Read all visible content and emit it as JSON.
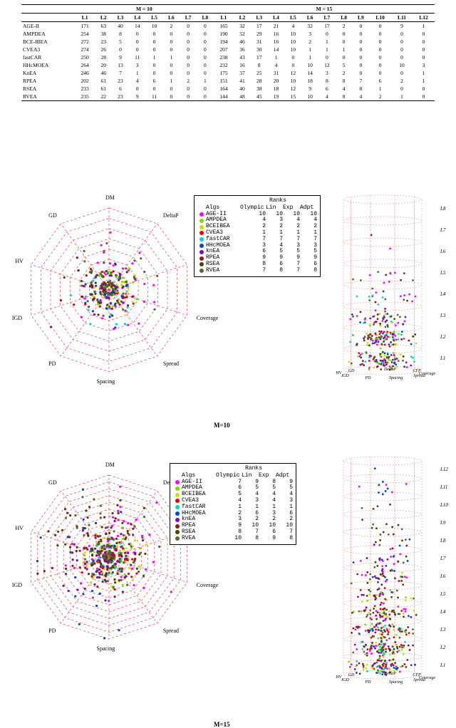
{
  "table": {
    "group_headers": [
      "M = 10",
      "M = 15"
    ],
    "columns_m10": [
      "L1",
      "L2",
      "L3",
      "L4",
      "L5",
      "L6",
      "L7",
      "L8"
    ],
    "columns_m15": [
      "L1",
      "L2",
      "L3",
      "L4",
      "L5",
      "L6",
      "L7",
      "L8",
      "L9",
      "L10",
      "L11",
      "L12"
    ],
    "rows": [
      {
        "name": "AGE-II",
        "m10": [
          171,
          63,
          40,
          14,
          10,
          2,
          0,
          0
        ],
        "m15": [
          165,
          32,
          17,
          21,
          4,
          32,
          17,
          2,
          0,
          0,
          9,
          1
        ]
      },
      {
        "name": "AMPDEA",
        "m10": [
          254,
          38,
          8,
          0,
          0,
          0,
          0,
          0
        ],
        "m15": [
          190,
          52,
          29,
          16,
          10,
          3,
          0,
          0,
          0,
          0,
          0,
          0
        ]
      },
      {
        "name": "BCE-IBEA",
        "m10": [
          272,
          23,
          5,
          0,
          0,
          0,
          0,
          0
        ],
        "m15": [
          194,
          46,
          31,
          16,
          10,
          2,
          1,
          0,
          0,
          0,
          0,
          0
        ]
      },
      {
        "name": "CVEA3",
        "m10": [
          274,
          26,
          0,
          0,
          0,
          0,
          0,
          0
        ],
        "m15": [
          207,
          36,
          30,
          14,
          10,
          1,
          1,
          1,
          0,
          0,
          0,
          0
        ]
      },
      {
        "name": "fastCAR",
        "m10": [
          250,
          28,
          9,
          11,
          1,
          1,
          0,
          0
        ],
        "m15": [
          238,
          43,
          17,
          1,
          0,
          1,
          0,
          0,
          0,
          0,
          0,
          0
        ]
      },
      {
        "name": "HHcMOEA",
        "m10": [
          264,
          20,
          13,
          3,
          0,
          0,
          0,
          0
        ],
        "m15": [
          232,
          16,
          8,
          4,
          0,
          10,
          12,
          5,
          0,
          0,
          10,
          3
        ]
      },
      {
        "name": "KnEA",
        "m10": [
          246,
          46,
          7,
          1,
          0,
          0,
          0,
          0
        ],
        "m15": [
          175,
          37,
          25,
          31,
          12,
          14,
          3,
          2,
          0,
          0,
          0,
          1
        ]
      },
      {
        "name": "RPEA",
        "m10": [
          202,
          61,
          23,
          4,
          6,
          1,
          2,
          1
        ],
        "m15": [
          151,
          41,
          28,
          20,
          10,
          18,
          8,
          8,
          7,
          6,
          2,
          1
        ]
      },
      {
        "name": "RSEA",
        "m10": [
          233,
          61,
          6,
          0,
          0,
          0,
          0,
          0
        ],
        "m15": [
          164,
          40,
          38,
          18,
          12,
          9,
          6,
          4,
          8,
          1,
          0,
          0
        ]
      },
      {
        "name": "RVEA",
        "m10": [
          235,
          22,
          23,
          9,
          11,
          0,
          0,
          0
        ],
        "m15": [
          144,
          48,
          45,
          19,
          15,
          10,
          4,
          8,
          4,
          2,
          1,
          0
        ]
      }
    ]
  },
  "axes": [
    "DM",
    "DeltaP",
    "CFP",
    "Coverage",
    "Spread",
    "Spacing",
    "PD",
    "IGD",
    "HV",
    "GD"
  ],
  "legend_header": {
    "algs": "Algs",
    "c1": "Olympic",
    "c2": "Lin",
    "c3": "Exp",
    "c4": "Adpt",
    "ranks": "Ranks"
  },
  "algorithms": [
    {
      "key": "AGE-II",
      "color": "#ff00ff"
    },
    {
      "key": "AMPDEA",
      "color": "#77dd00"
    },
    {
      "key": "BCEIBEA",
      "color": "#d8d800"
    },
    {
      "key": "CVEA3",
      "color": "#ee0000"
    },
    {
      "key": "fastCAR",
      "color": "#00d4d4"
    },
    {
      "key": "HHcMOEA",
      "color": "#0044dd"
    },
    {
      "key": "knEA",
      "color": "#8800cc"
    },
    {
      "key": "RPEA",
      "color": "#8b1a1a"
    },
    {
      "key": "RSEA",
      "color": "#444400"
    },
    {
      "key": "RVEA",
      "color": "#556b2f"
    }
  ],
  "chart_data": [
    {
      "id": "m10",
      "type": "radar",
      "title": "M=10",
      "axes": [
        "DM",
        "DeltaP",
        "CFP",
        "Coverage",
        "Spread",
        "Spacing",
        "PD",
        "IGD",
        "HV",
        "GD"
      ],
      "levels": 8,
      "level_labels_3d": [
        "L1",
        "L2",
        "L3",
        "L4",
        "L5",
        "L6",
        "L7",
        "L8"
      ],
      "ranks": [
        {
          "alg": "AGE-II",
          "Olympic": 10,
          "Lin": 10,
          "Exp": 10,
          "Adpt": 10
        },
        {
          "alg": "AMPDEA",
          "Olympic": 4,
          "Lin": 3,
          "Exp": 4,
          "Adpt": 4
        },
        {
          "alg": "BCEIBEA",
          "Olympic": 2,
          "Lin": 2,
          "Exp": 2,
          "Adpt": 2
        },
        {
          "alg": "CVEA3",
          "Olympic": 1,
          "Lin": 1,
          "Exp": 1,
          "Adpt": 1
        },
        {
          "alg": "fastCAR",
          "Olympic": 7,
          "Lin": 7,
          "Exp": 7,
          "Adpt": 7
        },
        {
          "alg": "HHcMOEA",
          "Olympic": 3,
          "Lin": 4,
          "Exp": 3,
          "Adpt": 3
        },
        {
          "alg": "knEA",
          "Olympic": 6,
          "Lin": 5,
          "Exp": 5,
          "Adpt": 5
        },
        {
          "alg": "RPEA",
          "Olympic": 9,
          "Lin": 9,
          "Exp": 9,
          "Adpt": 9
        },
        {
          "alg": "RSEA",
          "Olympic": 8,
          "Lin": 6,
          "Exp": 7,
          "Adpt": 6
        },
        {
          "alg": "RVEA",
          "Olympic": 7,
          "Lin": 8,
          "Exp": 7,
          "Adpt": 8
        }
      ]
    },
    {
      "id": "m15",
      "type": "radar",
      "title": "M=15",
      "axes": [
        "DM",
        "DeltaP",
        "CFP",
        "Coverage",
        "Spread",
        "Spacing",
        "PD",
        "IGD",
        "HV",
        "GD"
      ],
      "levels": 12,
      "level_labels_3d": [
        "L1",
        "L2",
        "L3",
        "L4",
        "L5",
        "L6",
        "L7",
        "L8",
        "L9",
        "L10",
        "L11",
        "L12"
      ],
      "ranks": [
        {
          "alg": "AGE-II",
          "Olympic": 7,
          "Lin": 9,
          "Exp": 8,
          "Adpt": 9
        },
        {
          "alg": "AMPDEA",
          "Olympic": 6,
          "Lin": 5,
          "Exp": 5,
          "Adpt": 5
        },
        {
          "alg": "BCEIBEA",
          "Olympic": 5,
          "Lin": 4,
          "Exp": 4,
          "Adpt": 4
        },
        {
          "alg": "CVEA3",
          "Olympic": 4,
          "Lin": 3,
          "Exp": 4,
          "Adpt": 3
        },
        {
          "alg": "fastCAR",
          "Olympic": 1,
          "Lin": 1,
          "Exp": 1,
          "Adpt": 1
        },
        {
          "alg": "HHcMOEA",
          "Olympic": 2,
          "Lin": 6,
          "Exp": 3,
          "Adpt": 6
        },
        {
          "alg": "knEA",
          "Olympic": 3,
          "Lin": 2,
          "Exp": 2,
          "Adpt": 2
        },
        {
          "alg": "RPEA",
          "Olympic": 9,
          "Lin": 10,
          "Exp": 10,
          "Adpt": 10
        },
        {
          "alg": "RSEA",
          "Olympic": 8,
          "Lin": 7,
          "Exp": 6,
          "Adpt": 7
        },
        {
          "alg": "RVEA",
          "Olympic": 10,
          "Lin": 8,
          "Exp": 9,
          "Adpt": 8
        }
      ]
    }
  ]
}
